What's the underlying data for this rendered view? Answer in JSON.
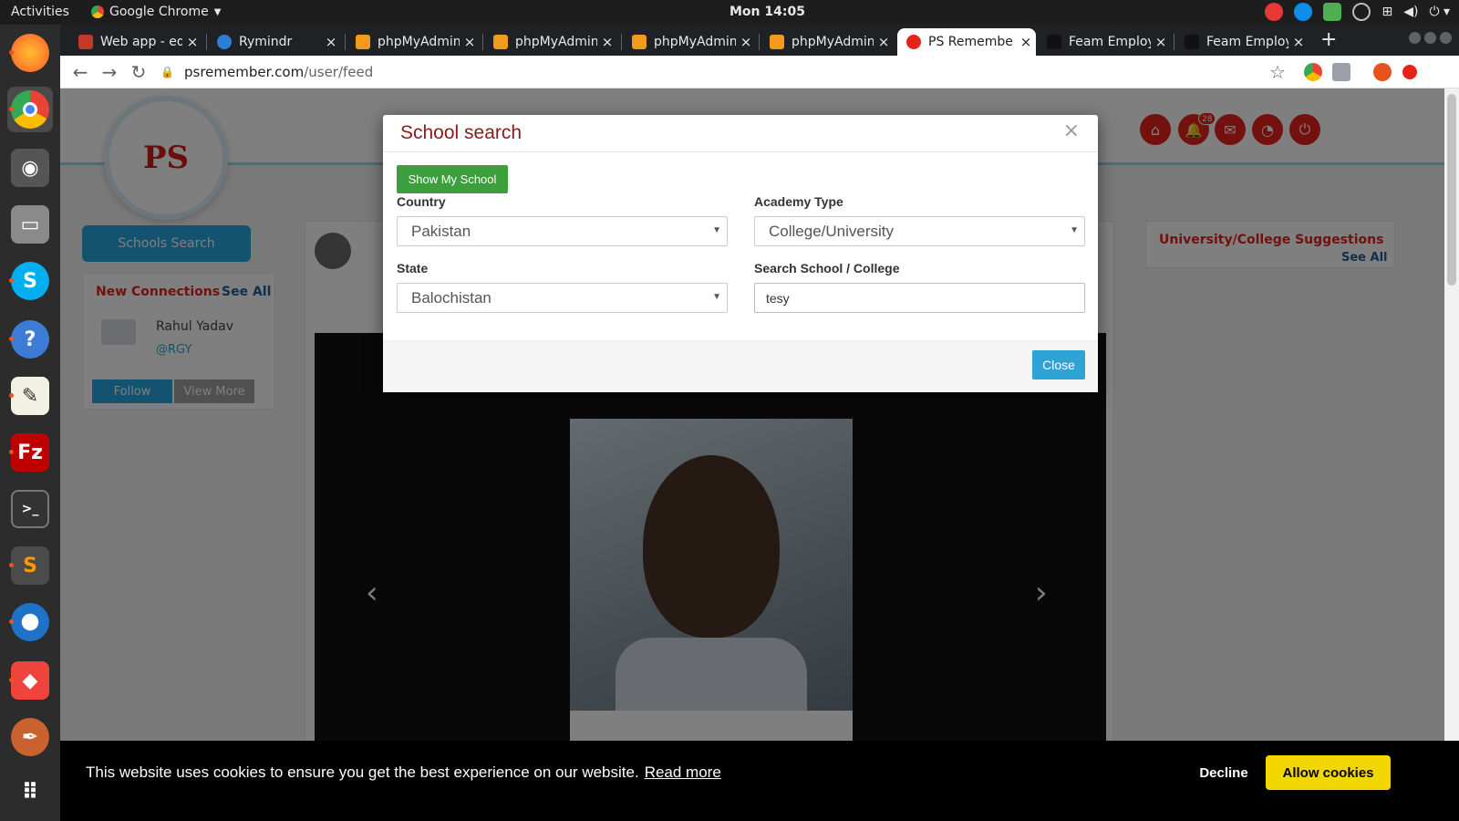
{
  "topbar": {
    "activities": "Activities",
    "app_name": "Google Chrome",
    "clock": "Mon 14:05"
  },
  "tabs": [
    {
      "label": "Web app - ed",
      "icon": "web-app-favicon",
      "color": "#c0392b"
    },
    {
      "label": "Rymindr",
      "icon": "rymindr-favicon",
      "color": "#2a7fd4"
    },
    {
      "label": "phpMyAdmin",
      "icon": "phpmyadmin-favicon",
      "color": "#f09a1e"
    },
    {
      "label": "phpMyAdmin",
      "icon": "phpmyadmin-favicon",
      "color": "#f09a1e"
    },
    {
      "label": "phpMyAdmin",
      "icon": "phpmyadmin-favicon",
      "color": "#f09a1e"
    },
    {
      "label": "phpMyAdmin",
      "icon": "phpmyadmin-favicon",
      "color": "#f09a1e"
    },
    {
      "label": "PS Remembe",
      "icon": "psremember-favicon",
      "color": "#e5231b"
    },
    {
      "label": "Feam Employ",
      "icon": "feam-favicon",
      "color": "#111111"
    },
    {
      "label": "Feam Employ",
      "icon": "feam-favicon",
      "color": "#111111"
    }
  ],
  "address": {
    "host": "psremember.com",
    "path": "/user/feed"
  },
  "header": {
    "logo_text": "PS",
    "notification_count": "28"
  },
  "sidebar": {
    "schools_search": "Schools Search",
    "connections_title": "New Connections",
    "see_all": "See All",
    "connection_name": "Rahul Yadav",
    "connection_handle": "@RGY",
    "follow": "Follow",
    "view_more": "View More"
  },
  "suggestions": {
    "title": "University/College Suggestions",
    "see_all": "See All"
  },
  "modal": {
    "title": "School search",
    "close_x": "×",
    "show_my_school": "Show My School",
    "country_label": "Country",
    "country_value": "Pakistan",
    "academy_label": "Academy Type",
    "academy_value": "College/University",
    "state_label": "State",
    "state_value": "Balochistan",
    "search_label": "Search School / College",
    "search_value": "tesy",
    "close_button": "Close"
  },
  "cookie": {
    "message": "This website uses cookies to ensure you get the best experience on our website.",
    "read_more": "Read more",
    "decline": "Decline",
    "allow": "Allow cookies"
  },
  "colors": {
    "accent_red": "#e5231b",
    "modal_title": "#8b1a1a",
    "green_button": "#3c9e3c",
    "blue_button": "#2ea3d6",
    "cookie_allow": "#f1d600"
  }
}
